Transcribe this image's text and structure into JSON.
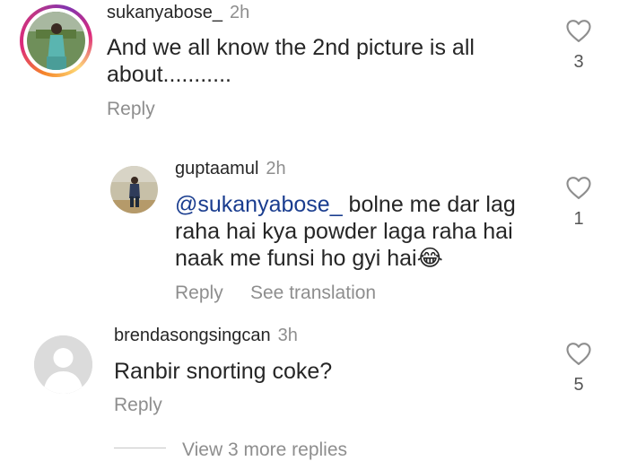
{
  "comments": [
    {
      "username": "sukanyabose_",
      "time": "2h",
      "text": "And we all know the 2nd picture is all about...........",
      "reply_label": "Reply",
      "likes": "3"
    },
    {
      "username": "guptaamul",
      "time": "2h",
      "mention": "@sukanyabose_",
      "text": " bolne me dar lag raha hai kya powder laga raha hai naak me funsi ho gyi hai",
      "emoji": "😂",
      "reply_label": "Reply",
      "translate_label": "See translation",
      "likes": "1"
    },
    {
      "username": "brendasongsingcan",
      "time": "3h",
      "text": "Ranbir snorting coke?",
      "reply_label": "Reply",
      "likes": "5"
    }
  ],
  "view_more_label": "View 3 more replies"
}
